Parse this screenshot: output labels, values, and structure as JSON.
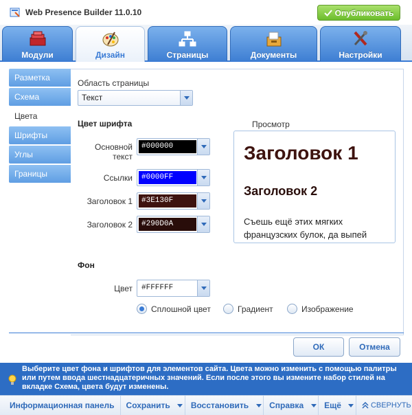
{
  "app": {
    "title": "Web Presence Builder 11.0.10",
    "publish_label": "Опубликовать"
  },
  "tabs": [
    {
      "label": "Модули",
      "icon": "modules-icon",
      "active": false
    },
    {
      "label": "Дизайн",
      "icon": "design-palette-icon",
      "active": true
    },
    {
      "label": "Страницы",
      "icon": "pages-sitemap-icon",
      "active": false
    },
    {
      "label": "Документы",
      "icon": "documents-box-icon",
      "active": false
    },
    {
      "label": "Настройки",
      "icon": "settings-tools-icon",
      "active": false
    }
  ],
  "sidebar": {
    "items": [
      {
        "label": "Разметка",
        "active": false
      },
      {
        "label": "Схема",
        "active": false
      },
      {
        "label": "Цвета",
        "active": true
      },
      {
        "label": "Шрифты",
        "active": false
      },
      {
        "label": "Углы",
        "active": false
      },
      {
        "label": "Границы",
        "active": false
      }
    ]
  },
  "page_area": {
    "label": "Область страницы",
    "selected": "Текст"
  },
  "font_color": {
    "title": "Цвет шрифта",
    "fields": [
      {
        "label": "Основной текст",
        "value": "#000000",
        "color": "#000000"
      },
      {
        "label": "Ссылки",
        "value": "#0000FF",
        "color": "#0000FF"
      },
      {
        "label": "Заголовок 1",
        "value": "#3E130F",
        "color": "#3E130F"
      },
      {
        "label": "Заголовок 2",
        "value": "#290D0A",
        "color": "#290D0A"
      }
    ]
  },
  "preview": {
    "label": "Просмотр",
    "heading1": "Заголовок 1",
    "heading2": "Заголовок 2",
    "body": "Съешь ещё этих мягких французских булок, да выпей"
  },
  "background": {
    "title": "Фон",
    "color_label": "Цвет",
    "color_value": "#FFFFFF",
    "options": [
      {
        "label": "Сплошной цвет",
        "checked": true
      },
      {
        "label": "Градиент",
        "checked": false
      },
      {
        "label": "Изображение",
        "checked": false
      }
    ]
  },
  "dialog_buttons": {
    "ok": "ОК",
    "cancel": "Отмена"
  },
  "info": {
    "text": "Выберите цвет фона и шрифтов для элементов сайта. Цвета можно изменить с помощью палитры или путем ввода шестнадцатеричных значений. Если после этого вы измените набор стилей на вкладке Схема, цвета будут изменены."
  },
  "bottom_bar": {
    "dashboard": "Информационная панель",
    "save": "Сохранить",
    "restore": "Восстановить",
    "help": "Справка",
    "more": "Ещё",
    "collapse": "СВЕРНУТЬ"
  },
  "colors": {
    "accent": "#3a7bd5",
    "publish": "#6cbd2c",
    "info_bar": "#2d6dc4"
  }
}
